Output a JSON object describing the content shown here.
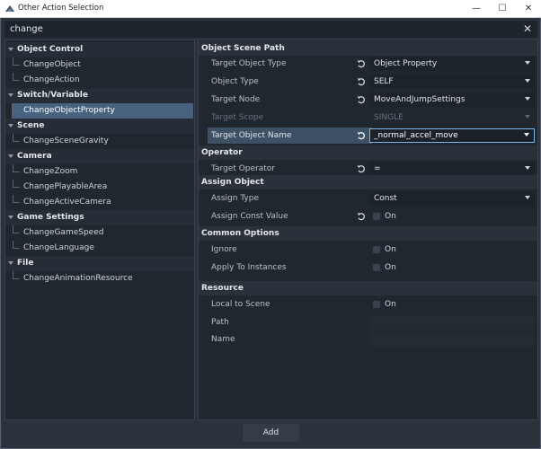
{
  "window": {
    "title": "Other Action Selection",
    "controls": {
      "minimize": "—",
      "maximize": "☐",
      "close": "✕"
    }
  },
  "search": {
    "value": "change",
    "clear_icon": "✕"
  },
  "tree": [
    {
      "category": "Object Control",
      "items": [
        "ChangeObject",
        "ChangeAction"
      ]
    },
    {
      "category": "Switch/Variable",
      "items": [
        "ChangeObjectProperty"
      ]
    },
    {
      "category": "Scene",
      "items": [
        "ChangeSceneGravity"
      ]
    },
    {
      "category": "Camera",
      "items": [
        "ChangeZoom",
        "ChangePlayableArea",
        "ChangeActiveCamera"
      ]
    },
    {
      "category": "Game Settings",
      "items": [
        "ChangeGameSpeed",
        "ChangeLanguage"
      ]
    },
    {
      "category": "File",
      "items": [
        "ChangeAnimationResource"
      ]
    }
  ],
  "selected_item": "ChangeObjectProperty",
  "properties": {
    "object_scene_path": {
      "header": "Object Scene Path",
      "target_object_type": {
        "label": "Target Object Type",
        "value": "Object Property"
      },
      "object_type": {
        "label": "Object Type",
        "value": "SELF"
      },
      "target_node": {
        "label": "Target Node",
        "value": "MoveAndJumpSettings"
      },
      "target_scope": {
        "label": "Target Scope",
        "value": "SINGLE"
      },
      "target_object_name": {
        "label": "Target Object Name",
        "value": "_normal_accel_move"
      }
    },
    "operator": {
      "header": "Operator",
      "target_operator": {
        "label": "Target Operator",
        "value": "="
      }
    },
    "assign_object": {
      "header": "Assign Object",
      "assign_type": {
        "label": "Assign Type",
        "value": "Const"
      },
      "assign_const_value": {
        "label": "Assign Const Value",
        "value": "On"
      }
    },
    "common_options": {
      "header": "Common Options",
      "ignore": {
        "label": "Ignore",
        "value": "On"
      },
      "apply_to_instances": {
        "label": "Apply To Instances",
        "value": "On"
      }
    },
    "resource": {
      "header": "Resource",
      "local_to_scene": {
        "label": "Local to Scene",
        "value": "On"
      },
      "path": {
        "label": "Path",
        "value": ""
      },
      "name": {
        "label": "Name",
        "value": ""
      }
    }
  },
  "footer": {
    "add_label": "Add"
  },
  "colors": {
    "selection": "#46627e",
    "highlight": "#3e5064",
    "focus_border": "#7fb6e8",
    "panel": "#21272f",
    "window_bg": "#2b323c"
  }
}
